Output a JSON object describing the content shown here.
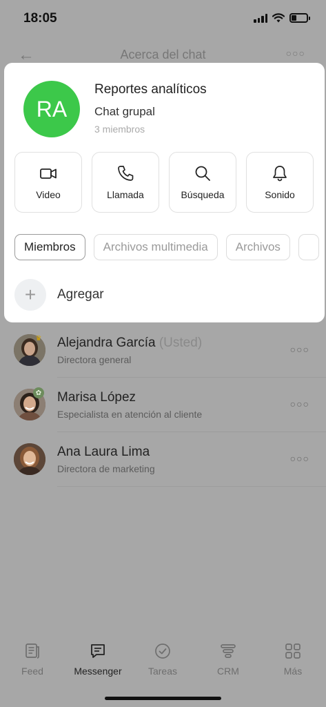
{
  "status_bar": {
    "time": "18:05"
  },
  "nav": {
    "title": "Acerca del chat"
  },
  "chat": {
    "avatar_initials": "RA",
    "avatar_color": "#3cc84a",
    "name": "Reportes analíticos",
    "type": "Chat grupal",
    "members_count": "3 miembros"
  },
  "actions": [
    {
      "label": "Video",
      "icon": "video-icon"
    },
    {
      "label": "Llamada",
      "icon": "phone-icon"
    },
    {
      "label": "Búsqueda",
      "icon": "search-icon"
    },
    {
      "label": "Sonido",
      "icon": "bell-icon"
    }
  ],
  "tabs": [
    {
      "label": "Miembros",
      "active": true
    },
    {
      "label": "Archivos multimedia",
      "active": false
    },
    {
      "label": "Archivos",
      "active": false
    }
  ],
  "add": {
    "label": "Agregar"
  },
  "members": [
    {
      "name": "Alejandra García",
      "suffix": "(Usted)",
      "role": "Directora general",
      "badge": "crown-icon"
    },
    {
      "name": "Marisa López",
      "suffix": "",
      "role": "Especialista en atención al cliente",
      "badge": "leaf-badge-icon"
    },
    {
      "name": "Ana Laura Lima",
      "suffix": "",
      "role": "Directora de marketing",
      "badge": ""
    }
  ],
  "tabbar": [
    {
      "label": "Feed",
      "icon": "feed-icon",
      "active": false
    },
    {
      "label": "Messenger",
      "icon": "messenger-icon",
      "active": true
    },
    {
      "label": "Tareas",
      "icon": "tasks-icon",
      "active": false
    },
    {
      "label": "CRM",
      "icon": "crm-icon",
      "active": false
    },
    {
      "label": "Más",
      "icon": "more-grid-icon",
      "active": false
    }
  ]
}
